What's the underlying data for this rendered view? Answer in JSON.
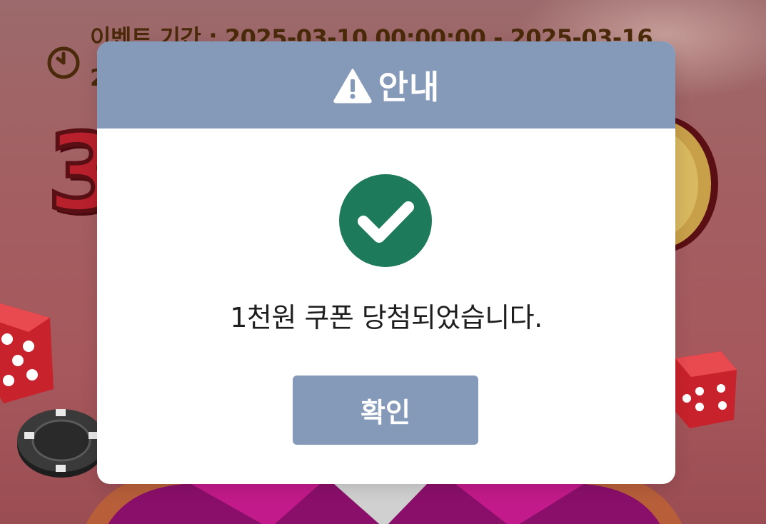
{
  "background": {
    "event_period_text": "이벤트 기간 : 2025-03-10 00:00:00 - 2025-03-16",
    "timer_continuation": "2",
    "headline_digit": "3",
    "icons": [
      "timer-icon",
      "dice-icon",
      "casino-chip-icon",
      "coin-icon",
      "roulette-wheel-icon"
    ]
  },
  "modal": {
    "title": "안내",
    "title_icon": "warning-triangle-icon",
    "status_icon": "check-circle-icon",
    "message": "1천원 쿠폰 당첨되었습니다.",
    "confirm_label": "확인"
  },
  "colors": {
    "header_bg": "#8599b9",
    "button_bg": "#8599b9",
    "success_green": "#1d7a5b",
    "page_bg": "#a35f62"
  }
}
